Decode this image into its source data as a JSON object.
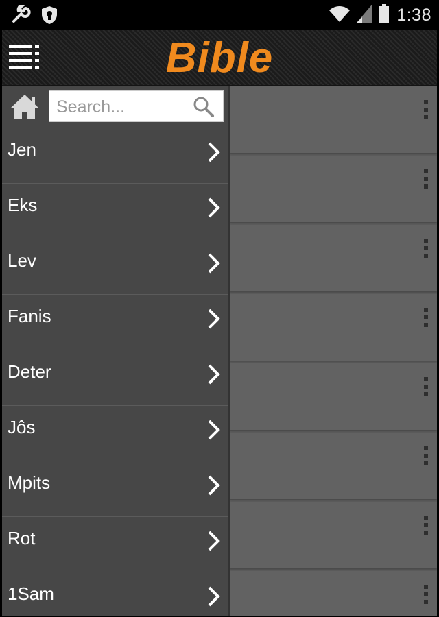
{
  "status_bar": {
    "time": "1:38",
    "left_icons": [
      "wrench-icon",
      "shield-icon"
    ],
    "right_icons": [
      "wifi-icon",
      "signal-icon",
      "battery-icon"
    ]
  },
  "action_bar": {
    "title": "Bible",
    "title_color": "#f08a1e",
    "menu_icon": "list-menu-icon"
  },
  "drawer": {
    "home_icon": "home-icon",
    "search": {
      "placeholder": "Search...",
      "value": "",
      "icon": "search-icon"
    },
    "books": [
      {
        "label": "Jen"
      },
      {
        "label": "Eks"
      },
      {
        "label": "Lev"
      },
      {
        "label": "Fanis"
      },
      {
        "label": "Deter"
      },
      {
        "label": "Jôs"
      },
      {
        "label": "Mpits"
      },
      {
        "label": "Rot"
      },
      {
        "label": "1Sam"
      }
    ]
  },
  "content_rows": [
    {
      "menu_icon": "overflow-menu-icon"
    },
    {
      "menu_icon": "overflow-menu-icon"
    },
    {
      "menu_icon": "overflow-menu-icon"
    },
    {
      "menu_icon": "overflow-menu-icon"
    },
    {
      "menu_icon": "overflow-menu-icon"
    },
    {
      "menu_icon": "overflow-menu-icon"
    },
    {
      "menu_icon": "overflow-menu-icon"
    },
    {
      "menu_icon": "overflow-menu-icon"
    }
  ]
}
